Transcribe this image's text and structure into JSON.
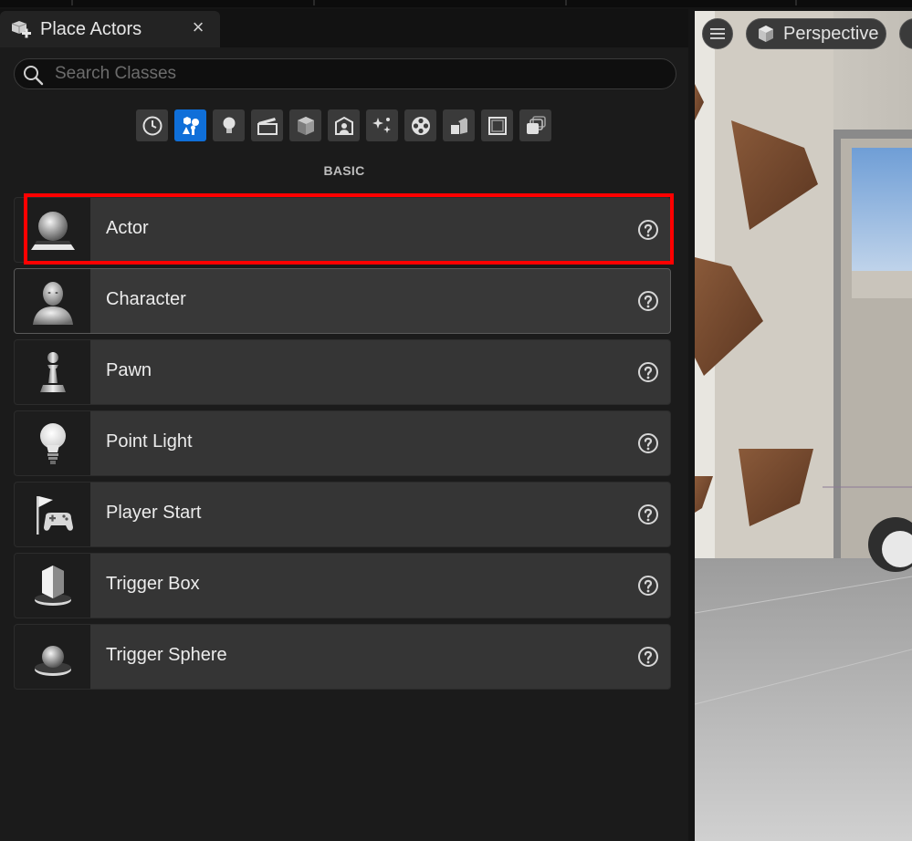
{
  "panel": {
    "tab_title": "Place Actors",
    "close_glyph": "×",
    "search_placeholder": "Search Classes",
    "categories": [
      {
        "icon": "clock-icon"
      },
      {
        "icon": "basic-shapes-icon",
        "active": true
      },
      {
        "icon": "lightbulb-icon"
      },
      {
        "icon": "cinematic-clapper-icon"
      },
      {
        "icon": "cube-icon"
      },
      {
        "icon": "portrait-icon"
      },
      {
        "icon": "sparkles-icon"
      },
      {
        "icon": "film-reel-icon"
      },
      {
        "icon": "geometry-blocks-icon"
      },
      {
        "icon": "volume-frame-icon"
      },
      {
        "icon": "stacked-layers-icon"
      }
    ],
    "section_label": "BASIC",
    "items": [
      {
        "label": "Actor",
        "icon": "sphere-on-base-icon"
      },
      {
        "label": "Character",
        "icon": "character-bust-icon"
      },
      {
        "label": "Pawn",
        "icon": "pawn-icon"
      },
      {
        "label": "Point Light",
        "icon": "lightbulb-icon"
      },
      {
        "label": "Player Start",
        "icon": "flag-gamepad-icon"
      },
      {
        "label": "Trigger Box",
        "icon": "cube-on-base-icon"
      },
      {
        "label": "Trigger Sphere",
        "icon": "sphere-on-base-icon"
      }
    ]
  },
  "viewport": {
    "view_mode_label": "Perspective"
  },
  "colors": {
    "accent": "#0f6fd9",
    "highlight": "#ff0000",
    "panel_bg": "#1b1b1b",
    "item_bg": "#353535"
  }
}
